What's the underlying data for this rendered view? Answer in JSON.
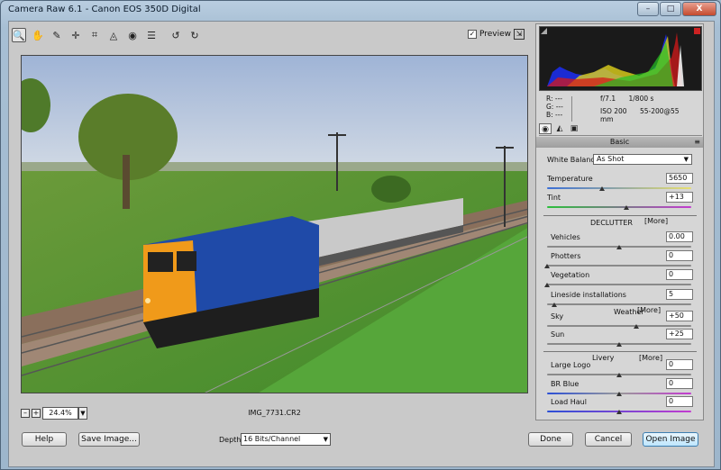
{
  "window": {
    "title": "Camera Raw 6.1 - Canon EOS 350D Digital",
    "min": "–",
    "max": "□",
    "close": "X"
  },
  "toolbar": {
    "tools": [
      {
        "name": "zoom-icon",
        "glyph": "🔍"
      },
      {
        "name": "hand-icon",
        "glyph": "✋"
      },
      {
        "name": "white-balance-icon",
        "glyph": "✎"
      },
      {
        "name": "color-sampler-icon",
        "glyph": "✛"
      },
      {
        "name": "crop-icon",
        "glyph": "⌗"
      },
      {
        "name": "straighten-icon",
        "glyph": "◬"
      },
      {
        "name": "red-eye-icon",
        "glyph": "◉"
      },
      {
        "name": "preferences-icon",
        "glyph": "☰"
      },
      {
        "name": "rotate-left-icon",
        "glyph": "↺"
      },
      {
        "name": "rotate-right-icon",
        "glyph": "↻"
      }
    ],
    "preview_label": "Preview",
    "preview_checked": "✓",
    "fullscreen_glyph": "⇲"
  },
  "status": {
    "zoom_out": "–",
    "zoom_in": "+",
    "zoom": "24.4%",
    "zoom_arrow": "▼",
    "filename": "IMG_7731.CR2"
  },
  "readout": {
    "r": "R:  ---",
    "g": "G:  ---",
    "b": "B:  ---",
    "aperture": "f/7.1",
    "shutter": "1/800 s",
    "iso": "ISO 200",
    "lens": "55-200@55 mm"
  },
  "tabs": [
    {
      "name": "basic-tab-icon",
      "glyph": "◉"
    },
    {
      "name": "tone-curve-tab-icon",
      "glyph": "◭"
    },
    {
      "name": "camera-tab-icon",
      "glyph": "▣"
    }
  ],
  "panel": {
    "section": "Basic",
    "menu_glyph": "≡",
    "white_balance_label": "White Balance:",
    "white_balance_value": "As Shot",
    "arrow": "▼",
    "sliders": [
      {
        "label": "Temperature",
        "value": "5650",
        "pos": 0.38
      },
      {
        "label": "Tint",
        "value": "+13",
        "pos": 0.55
      }
    ],
    "declutter": {
      "heading": "DECLUTTER",
      "more": "[More]",
      "sliders": [
        {
          "label": "Vehicles",
          "value": "0.00",
          "pos": 0.5
        },
        {
          "label": "Photters",
          "value": "0",
          "pos": 0.0
        },
        {
          "label": "Vegetation",
          "value": "0",
          "pos": 0.0
        },
        {
          "label": "Lineside installations",
          "value": "5",
          "pos": 0.05
        }
      ]
    },
    "weather": {
      "heading": "Weather",
      "more": "[More]",
      "sliders": [
        {
          "label": "Sky",
          "value": "+50",
          "pos": 0.62
        },
        {
          "label": "Sun",
          "value": "+25",
          "pos": 0.5
        }
      ]
    },
    "livery": {
      "heading": "Livery",
      "more": "[More]",
      "sliders": [
        {
          "label": "Large Logo",
          "value": "0",
          "pos": 0.5
        },
        {
          "label": "BR Blue",
          "value": "0",
          "pos": 0.5
        },
        {
          "label": "Load Haul",
          "value": "0",
          "pos": 0.5
        }
      ]
    }
  },
  "bottom": {
    "help": "Help",
    "save": "Save Image...",
    "depth_label": "Depth:",
    "depth_value": "16 Bits/Channel",
    "done": "Done",
    "cancel": "Cancel",
    "open": "Open Image"
  }
}
